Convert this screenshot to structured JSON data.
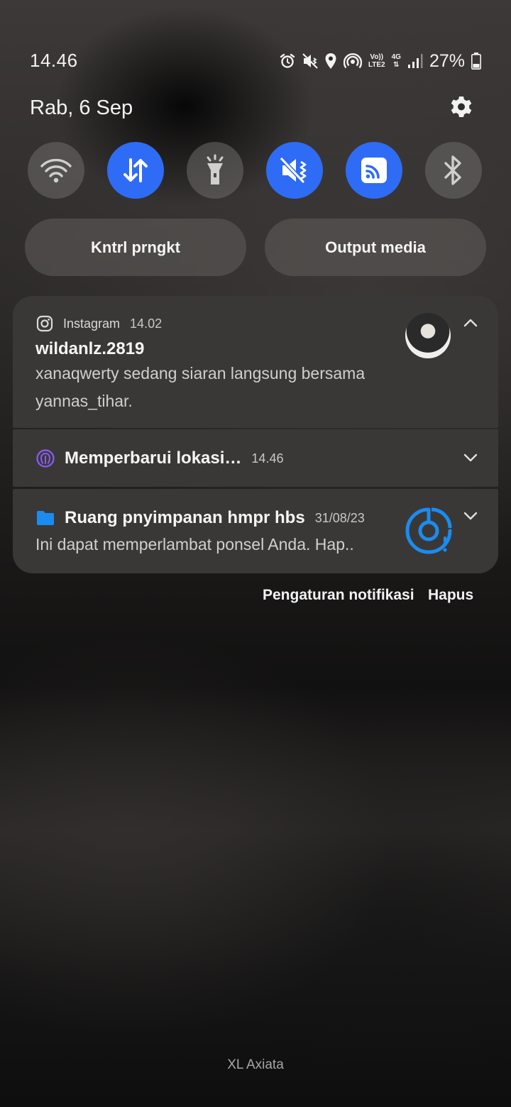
{
  "status_bar": {
    "time": "14.46",
    "network_top": "Vo))",
    "network_bottom": "LTE2",
    "data_type": "4G",
    "battery_percent": "27%"
  },
  "header": {
    "date": "Rab, 6 Sep"
  },
  "quick_toggles": [
    {
      "name": "wifi",
      "icon": "wifi-icon",
      "on": false
    },
    {
      "name": "mobile-data",
      "icon": "data-transfer-icon",
      "on": true
    },
    {
      "name": "flashlight",
      "icon": "flashlight-icon",
      "on": false
    },
    {
      "name": "sound",
      "icon": "mute-vibrate-icon",
      "on": true
    },
    {
      "name": "cast",
      "icon": "cast-icon",
      "on": true
    },
    {
      "name": "bluetooth",
      "icon": "bluetooth-icon",
      "on": false
    }
  ],
  "buttons": {
    "device_control": "Kntrl prngkt",
    "media_output": "Output media"
  },
  "notifications": {
    "instagram": {
      "app": "Instagram",
      "time": "14.02",
      "title": "wildanlz.2819",
      "body": "xanaqwerty sedang siaran langsung bersama yannas_tihar."
    },
    "location": {
      "title": "Memperbarui lokasi…",
      "time": "14.46"
    },
    "storage": {
      "title": "Ruang pnyimpanan hmpr hbs",
      "time": "31/08/23",
      "body": "Ini dapat memperlambat ponsel Anda. Hap.."
    }
  },
  "footer": {
    "notification_settings": "Pengaturan notifikasi",
    "clear": "Hapus"
  },
  "carrier": "XL Axiata",
  "colors": {
    "accent_blue": "#2f6cf5",
    "card_bg": "#3a3837",
    "location_purple": "#8a5cf6",
    "storage_blue": "#1a8cf0"
  }
}
